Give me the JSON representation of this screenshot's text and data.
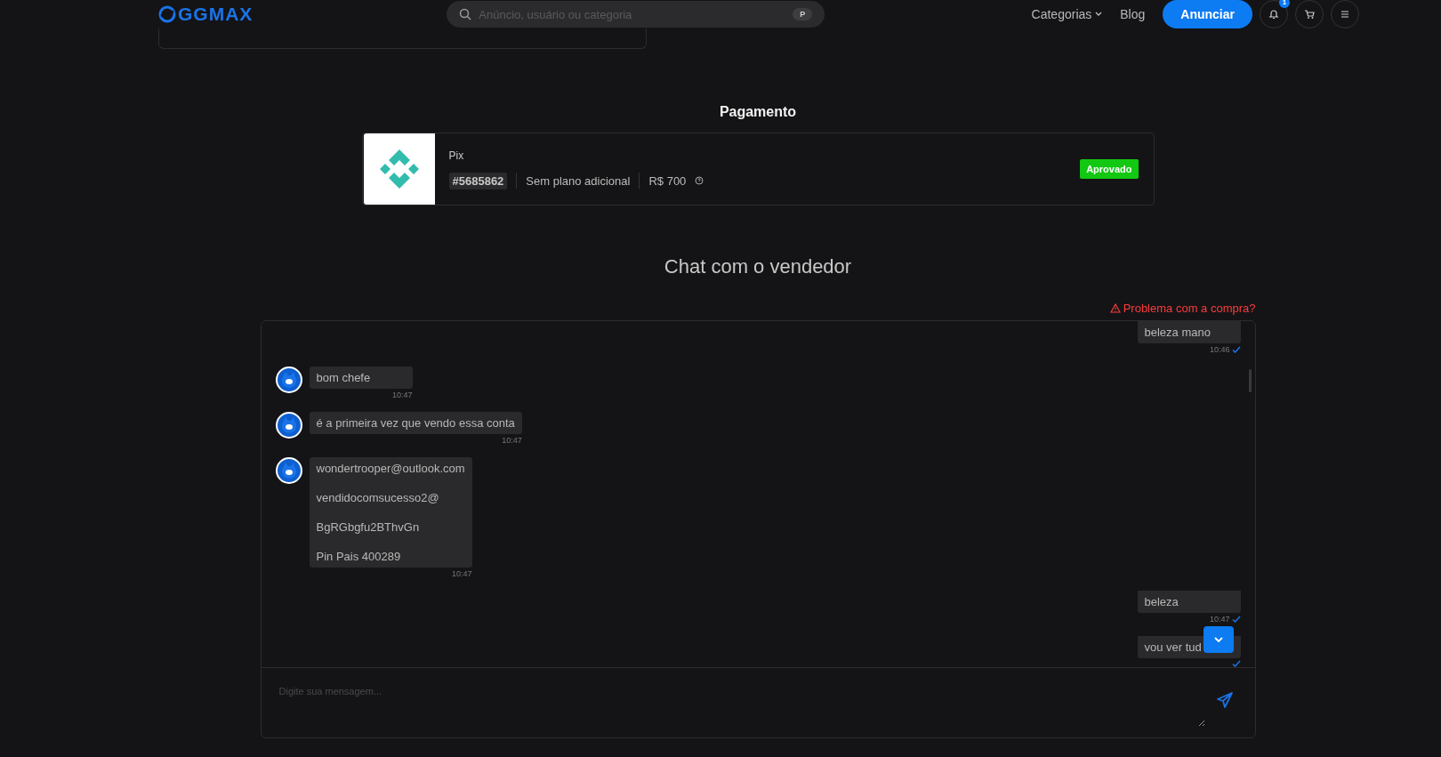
{
  "header": {
    "logo": "GGMAX",
    "search": {
      "placeholder": "Anúncio, usuário ou categoria",
      "shortcut": "P"
    },
    "nav": [
      "Categorias",
      "Blog"
    ],
    "cta": "Anunciar",
    "notification_count": "1"
  },
  "payment": {
    "title": "Pagamento",
    "method": "Pix",
    "order_id": "#5685862",
    "plan": "Sem plano adicional",
    "amount": "R$ 700",
    "status": "Aprovado"
  },
  "chat": {
    "title": "Chat com o vendedor",
    "report_link": "Problema com a compra?",
    "input_placeholder": "Digite sua mensagem...",
    "messages": [
      {
        "kind": "sent",
        "lines": [
          "beleza mano"
        ],
        "time": "10:46",
        "read": true
      },
      {
        "kind": "received",
        "lines": [
          "bom chefe"
        ],
        "time": "10:47"
      },
      {
        "kind": "received",
        "lines": [
          "é a primeira vez que vendo essa conta"
        ],
        "time": "10:47"
      },
      {
        "kind": "received",
        "lines": [
          "wondertrooper@outlook.com",
          "vendidocomsucesso2@",
          "BgRGbgfu2BThvGn",
          "Pin Pais 400289"
        ],
        "time": "10:47"
      },
      {
        "kind": "sent",
        "lines": [
          "beleza"
        ],
        "time": "10:47",
        "read": true
      },
      {
        "kind": "sent",
        "lines": [
          "vou ver tud"
        ],
        "read": true
      }
    ]
  }
}
